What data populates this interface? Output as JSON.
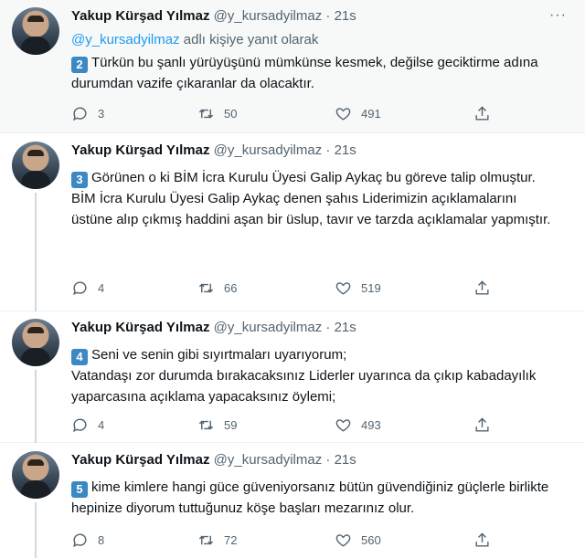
{
  "author": {
    "name": "Yakup Kürşad Yılmaz",
    "handle": "@y_kursadyilmaz",
    "separator": "·"
  },
  "colors": {
    "link": "#1d9bf0",
    "number_badge": "#3b88c3",
    "muted": "#536471"
  },
  "tweets": [
    {
      "time": "21s",
      "reply_prefix": "@y_kursadyilmaz",
      "reply_suffix": " adlı kişiye yanıt olarak",
      "badge": "2",
      "lines": [
        "Türkün bu şanlı yürüyüşünü mümkünse kesmek, değilse geciktirme adına durumdan vazife çıkaranlar da olacaktır."
      ],
      "replies": "3",
      "retweets": "50",
      "likes": "491"
    },
    {
      "time": "21s",
      "badge": "3",
      "lines": [
        "Görünen o ki BİM İcra Kurulu Üyesi Galip Aykaç  bu göreve talip olmuştur.",
        "BİM İcra Kurulu Üyesi Galip Aykaç denen şahıs Liderimizin açıklamalarını üstüne alıp çıkmış haddini aşan bir üslup, tavır ve tarzda açıklamalar yapmıştır."
      ],
      "replies": "4",
      "retweets": "66",
      "likes": "519"
    },
    {
      "time": "21s",
      "badge": "4",
      "lines": [
        "Seni ve senin gibi sıyırtmaları uyarıyorum;",
        "Vatandaşı zor durumda bırakacaksınız Liderler uyarınca da çıkıp kabadayılık yaparcasına açıklama yapacaksınız öylemi;"
      ],
      "replies": "4",
      "retweets": "59",
      "likes": "493"
    },
    {
      "time": "21s",
      "badge": "5",
      "lines": [
        "kime kimlere hangi güce güveniyorsanız bütün güvendiğiniz güçlerle birlikte hepinize diyorum tuttuğunuz köşe başları mezarınız olur."
      ],
      "replies": "8",
      "retweets": "72",
      "likes": "560"
    }
  ]
}
